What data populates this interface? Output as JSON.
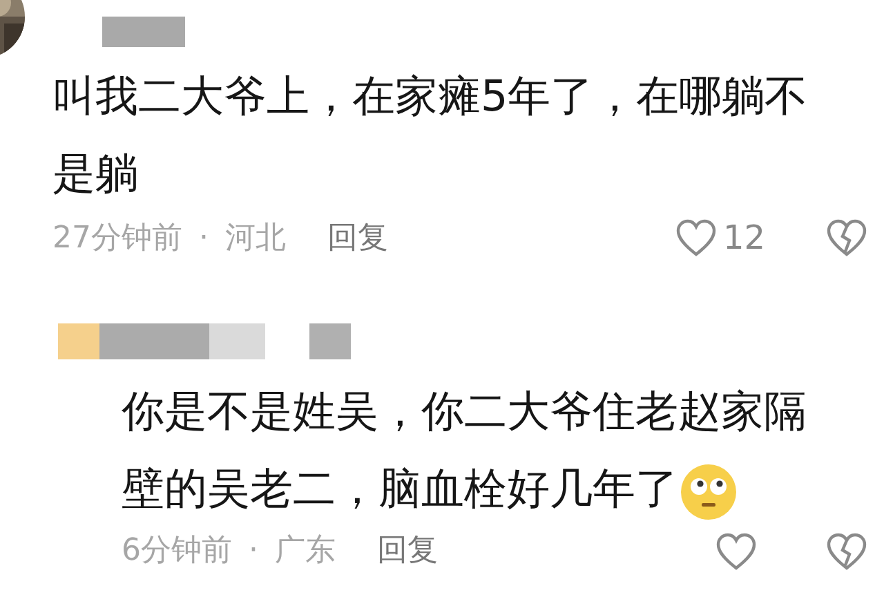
{
  "comments": [
    {
      "kind": "top",
      "text": "叫我二大爷上，在家瘫5年了，在哪躺不是躺",
      "time": "27分钟前",
      "dot": "·",
      "location": "河北",
      "reply": "回复",
      "likes": "12",
      "emoji": false
    },
    {
      "kind": "reply",
      "text": "你是不是姓吴，你二大爷住老赵家隔壁的吴老二，脑血栓好几年了",
      "time": "6分钟前",
      "dot": "·",
      "location": "广东",
      "reply": "回复",
      "emoji": true
    }
  ]
}
